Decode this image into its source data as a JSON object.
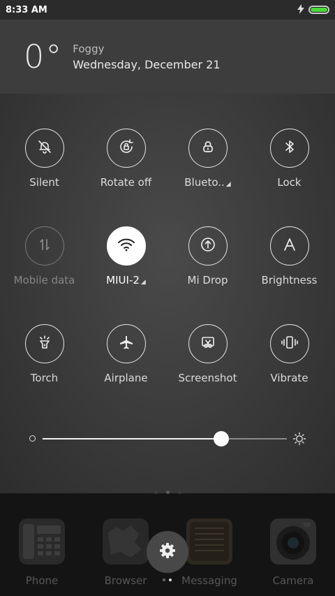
{
  "status_bar": {
    "time": "8:33 AM",
    "battery_level": 1.0,
    "battery_color": "#4cd83a",
    "charging_icon": "bolt-icon"
  },
  "weather": {
    "temperature": "0°",
    "condition": "Foggy",
    "date": "Wednesday, December 21"
  },
  "toggles": [
    [
      {
        "label": "Silent",
        "icon": "bell-off-icon",
        "state": "off"
      },
      {
        "label": "Rotate off",
        "icon": "rotate-lock-icon",
        "state": "off"
      },
      {
        "label": "Lock",
        "icon": "lock-icon",
        "state": "off"
      },
      {
        "label": "Blueto..",
        "icon": "bluetooth-icon",
        "state": "off",
        "has_more": true
      }
    ],
    [
      {
        "label": "Mobile data",
        "icon": "mobile-data-icon",
        "state": "disabled"
      },
      {
        "label": "MIUI-2",
        "icon": "wifi-icon",
        "state": "on",
        "has_more": true
      },
      {
        "label": "Mi Drop",
        "icon": "mi-drop-icon",
        "state": "off"
      },
      {
        "label": "Brightness",
        "icon": "auto-brightness-icon",
        "state": "off"
      }
    ],
    [
      {
        "label": "Torch",
        "icon": "torch-icon",
        "state": "off"
      },
      {
        "label": "Airplane",
        "icon": "airplane-icon",
        "state": "off"
      },
      {
        "label": "Screenshot",
        "icon": "screenshot-icon",
        "state": "off"
      },
      {
        "label": "Vibrate",
        "icon": "vibrate-icon",
        "state": "off"
      }
    ]
  ],
  "brightness": {
    "level": 0.73
  },
  "dock": {
    "apps": [
      {
        "label": "Phone",
        "icon": "phone-app-icon"
      },
      {
        "label": "Browser",
        "icon": "browser-app-icon"
      },
      {
        "label": "Messaging",
        "icon": "messaging-app-icon"
      },
      {
        "label": "Camera",
        "icon": "camera-app-icon"
      }
    ],
    "settings_icon": "gear-icon"
  }
}
